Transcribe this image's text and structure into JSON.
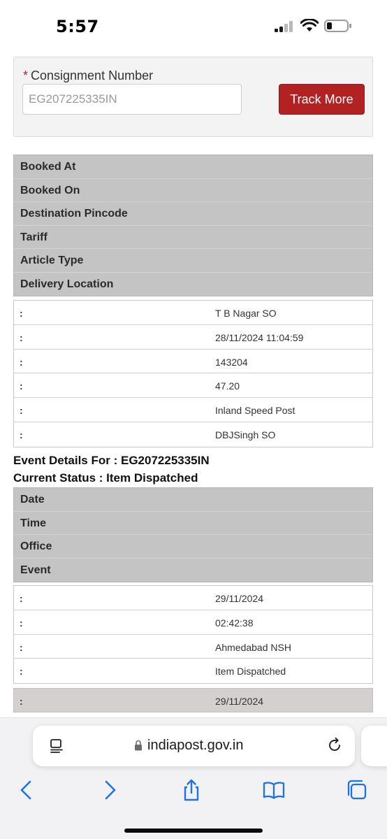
{
  "status_bar": {
    "time": "5:57"
  },
  "tracking_form": {
    "label": "Consignment Number",
    "required_mark": "*",
    "input_value": "EG207225335IN",
    "button_label": "Track More"
  },
  "booking": {
    "headers": [
      "Booked At",
      "Booked On",
      "Destination Pincode",
      "Tariff",
      "Article Type",
      "Delivery Location"
    ],
    "rows": [
      {
        "colon": ":",
        "value": "T B Nagar SO"
      },
      {
        "colon": ":",
        "value": "28/11/2024 11:04:59"
      },
      {
        "colon": ":",
        "value": "143204"
      },
      {
        "colon": ":",
        "value": "47.20"
      },
      {
        "colon": ":",
        "value": "Inland Speed Post"
      },
      {
        "colon": ":",
        "value": "DBJSingh SO"
      }
    ]
  },
  "events": {
    "details_title": "Event Details For : EG207225335IN",
    "status_title": "Current Status : Item Dispatched",
    "headers": [
      "Date",
      "Time",
      "Office",
      "Event"
    ],
    "rows": [
      {
        "colon": ":",
        "value": "29/11/2024"
      },
      {
        "colon": ":",
        "value": "02:42:38"
      },
      {
        "colon": ":",
        "value": "Ahmedabad NSH"
      },
      {
        "colon": ":",
        "value": "Item Dispatched"
      }
    ],
    "next_row": {
      "colon": ":",
      "value": "29/11/2024"
    }
  },
  "browser": {
    "url": "indiapost.gov.in",
    "accent_color": "#1a73e8"
  },
  "colors": {
    "button_red": "#b22222",
    "header_grey": "#c4c4c4"
  }
}
